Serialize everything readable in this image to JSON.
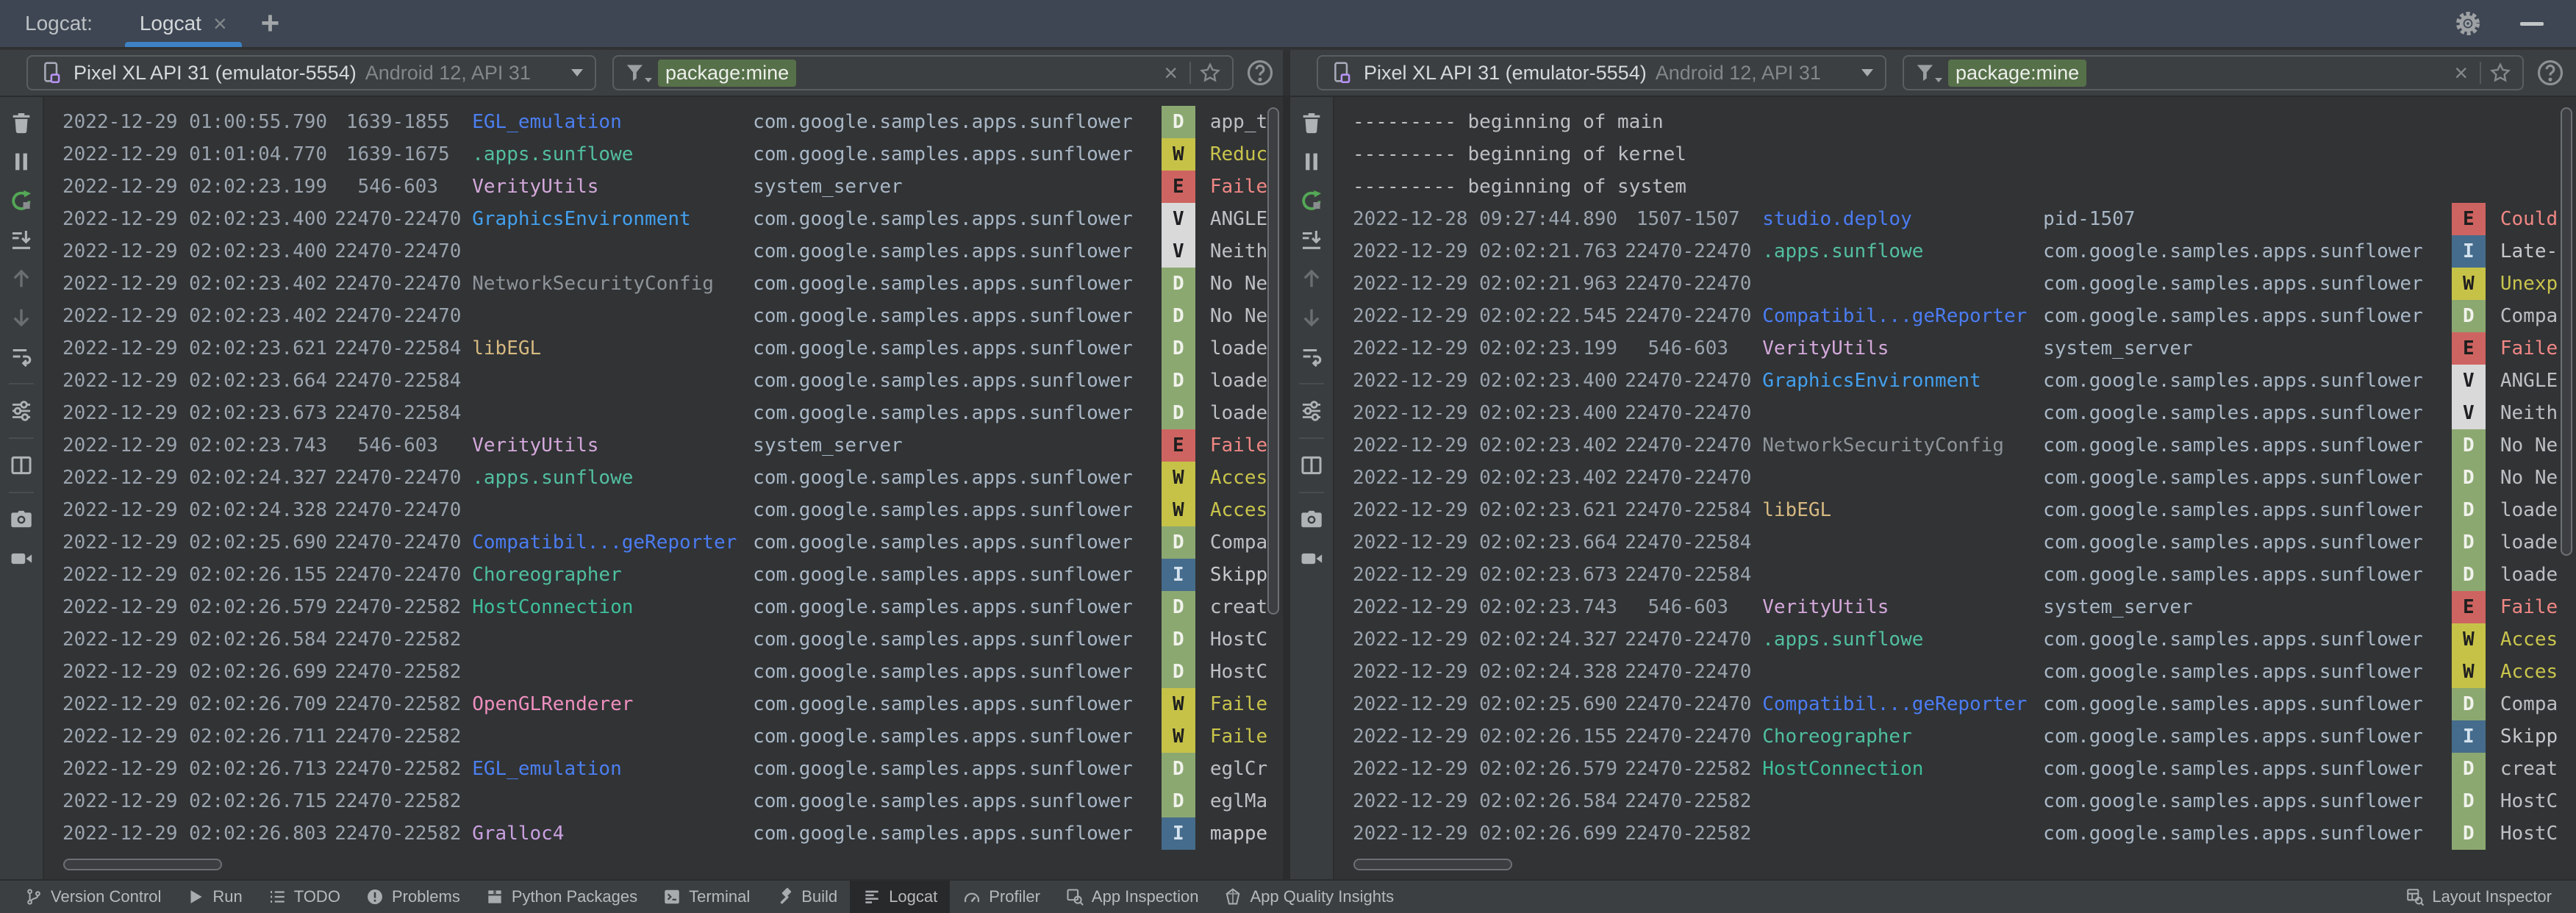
{
  "window": {
    "panel_label": "Logcat:",
    "tab_title": "Logcat",
    "close_glyph": "×",
    "add_glyph": "+"
  },
  "device_selector": {
    "device_name": "Pixel XL API 31 (emulator-5554)",
    "device_details": "Android 12, API 31"
  },
  "filter": {
    "token": "package:mine",
    "clear_glyph": "×",
    "help_glyph": "?"
  },
  "log_toolbar": [
    {
      "name": "clear-logcat",
      "icon": "trash"
    },
    {
      "name": "pause-logcat",
      "icon": "pause"
    },
    {
      "name": "restart-logcat",
      "icon": "restart"
    },
    {
      "name": "scroll-to-end",
      "icon": "scroll-end"
    },
    {
      "name": "previous-occurrence",
      "icon": "arrow-up",
      "dim": true
    },
    {
      "name": "next-occurrence",
      "icon": "arrow-down",
      "dim": true
    },
    {
      "name": "soft-wrap",
      "icon": "soft-wrap"
    },
    {
      "divider": true
    },
    {
      "name": "configure-logcat",
      "icon": "sliders"
    },
    {
      "divider": true
    },
    {
      "name": "split-panels",
      "icon": "split"
    },
    {
      "divider": true
    },
    {
      "name": "take-screenshot",
      "icon": "camera"
    },
    {
      "name": "record-screen",
      "icon": "video"
    }
  ],
  "panels": [
    {
      "rows": [
        [
          "2022-12-29 01:00:55.790",
          "1639-1855",
          "EGL_emulation",
          "com.google.samples.apps.sunflower",
          "D",
          "app_t"
        ],
        [
          "2022-12-29 01:01:04.770",
          "1639-1675",
          ".apps.sunflowe",
          "com.google.samples.apps.sunflower",
          "W",
          "Reduc"
        ],
        [
          "2022-12-29 02:02:23.199",
          "546-603",
          "VerityUtils",
          "system_server",
          "E",
          "Faile"
        ],
        [
          "2022-12-29 02:02:23.400",
          "22470-22470",
          "GraphicsEnvironment",
          "com.google.samples.apps.sunflower",
          "V",
          "ANGLE"
        ],
        [
          "2022-12-29 02:02:23.400",
          "22470-22470",
          "",
          "com.google.samples.apps.sunflower",
          "V",
          "Neith"
        ],
        [
          "2022-12-29 02:02:23.402",
          "22470-22470",
          "NetworkSecurityConfig",
          "com.google.samples.apps.sunflower",
          "D",
          "No Ne"
        ],
        [
          "2022-12-29 02:02:23.402",
          "22470-22470",
          "",
          "com.google.samples.apps.sunflower",
          "D",
          "No Ne"
        ],
        [
          "2022-12-29 02:02:23.621",
          "22470-22584",
          "libEGL",
          "com.google.samples.apps.sunflower",
          "D",
          "loade"
        ],
        [
          "2022-12-29 02:02:23.664",
          "22470-22584",
          "",
          "com.google.samples.apps.sunflower",
          "D",
          "loade"
        ],
        [
          "2022-12-29 02:02:23.673",
          "22470-22584",
          "",
          "com.google.samples.apps.sunflower",
          "D",
          "loade"
        ],
        [
          "2022-12-29 02:02:23.743",
          "546-603",
          "VerityUtils",
          "system_server",
          "E",
          "Faile"
        ],
        [
          "2022-12-29 02:02:24.327",
          "22470-22470",
          ".apps.sunflowe",
          "com.google.samples.apps.sunflower",
          "W",
          "Acces"
        ],
        [
          "2022-12-29 02:02:24.328",
          "22470-22470",
          "",
          "com.google.samples.apps.sunflower",
          "W",
          "Acces"
        ],
        [
          "2022-12-29 02:02:25.690",
          "22470-22470",
          "Compatibil...geReporter",
          "com.google.samples.apps.sunflower",
          "D",
          "Compa"
        ],
        [
          "2022-12-29 02:02:26.155",
          "22470-22470",
          "Choreographer",
          "com.google.samples.apps.sunflower",
          "I",
          "Skipp"
        ],
        [
          "2022-12-29 02:02:26.579",
          "22470-22582",
          "HostConnection",
          "com.google.samples.apps.sunflower",
          "D",
          "creat"
        ],
        [
          "2022-12-29 02:02:26.584",
          "22470-22582",
          "",
          "com.google.samples.apps.sunflower",
          "D",
          "HostC"
        ],
        [
          "2022-12-29 02:02:26.699",
          "22470-22582",
          "",
          "com.google.samples.apps.sunflower",
          "D",
          "HostC"
        ],
        [
          "2022-12-29 02:02:26.709",
          "22470-22582",
          "OpenGLRenderer",
          "com.google.samples.apps.sunflower",
          "W",
          "Faile"
        ],
        [
          "2022-12-29 02:02:26.711",
          "22470-22582",
          "",
          "com.google.samples.apps.sunflower",
          "W",
          "Faile"
        ],
        [
          "2022-12-29 02:02:26.713",
          "22470-22582",
          "EGL_emulation",
          "com.google.samples.apps.sunflower",
          "D",
          "eglCr"
        ],
        [
          "2022-12-29 02:02:26.715",
          "22470-22582",
          "",
          "com.google.samples.apps.sunflower",
          "D",
          "eglMa"
        ],
        [
          "2022-12-29 02:02:26.803",
          "22470-22582",
          "Gralloc4",
          "com.google.samples.apps.sunflower",
          "I",
          "mappe"
        ]
      ]
    },
    {
      "rows": [
        {
          "sep": "--------- beginning of main"
        },
        {
          "sep": "--------- beginning of kernel"
        },
        {
          "sep": "--------- beginning of system"
        },
        [
          "2022-12-28 09:27:44.890",
          "1507-1507",
          "studio.deploy",
          "pid-1507",
          "E",
          "Could"
        ],
        [
          "2022-12-29 02:02:21.763",
          "22470-22470",
          ".apps.sunflowe",
          "com.google.samples.apps.sunflower",
          "I",
          "Late-"
        ],
        [
          "2022-12-29 02:02:21.963",
          "22470-22470",
          "",
          "com.google.samples.apps.sunflower",
          "W",
          "Unexp"
        ],
        [
          "2022-12-29 02:02:22.545",
          "22470-22470",
          "Compatibil...geReporter",
          "com.google.samples.apps.sunflower",
          "D",
          "Compa"
        ],
        [
          "2022-12-29 02:02:23.199",
          "546-603",
          "VerityUtils",
          "system_server",
          "E",
          "Faile"
        ],
        [
          "2022-12-29 02:02:23.400",
          "22470-22470",
          "GraphicsEnvironment",
          "com.google.samples.apps.sunflower",
          "V",
          "ANGLE"
        ],
        [
          "2022-12-29 02:02:23.400",
          "22470-22470",
          "",
          "com.google.samples.apps.sunflower",
          "V",
          "Neith"
        ],
        [
          "2022-12-29 02:02:23.402",
          "22470-22470",
          "NetworkSecurityConfig",
          "com.google.samples.apps.sunflower",
          "D",
          "No Ne"
        ],
        [
          "2022-12-29 02:02:23.402",
          "22470-22470",
          "",
          "com.google.samples.apps.sunflower",
          "D",
          "No Ne"
        ],
        [
          "2022-12-29 02:02:23.621",
          "22470-22584",
          "libEGL",
          "com.google.samples.apps.sunflower",
          "D",
          "loade"
        ],
        [
          "2022-12-29 02:02:23.664",
          "22470-22584",
          "",
          "com.google.samples.apps.sunflower",
          "D",
          "loade"
        ],
        [
          "2022-12-29 02:02:23.673",
          "22470-22584",
          "",
          "com.google.samples.apps.sunflower",
          "D",
          "loade"
        ],
        [
          "2022-12-29 02:02:23.743",
          "546-603",
          "VerityUtils",
          "system_server",
          "E",
          "Faile"
        ],
        [
          "2022-12-29 02:02:24.327",
          "22470-22470",
          ".apps.sunflowe",
          "com.google.samples.apps.sunflower",
          "W",
          "Acces"
        ],
        [
          "2022-12-29 02:02:24.328",
          "22470-22470",
          "",
          "com.google.samples.apps.sunflower",
          "W",
          "Acces"
        ],
        [
          "2022-12-29 02:02:25.690",
          "22470-22470",
          "Compatibil...geReporter",
          "com.google.samples.apps.sunflower",
          "D",
          "Compa"
        ],
        [
          "2022-12-29 02:02:26.155",
          "22470-22470",
          "Choreographer",
          "com.google.samples.apps.sunflower",
          "I",
          "Skipp"
        ],
        [
          "2022-12-29 02:02:26.579",
          "22470-22582",
          "HostConnection",
          "com.google.samples.apps.sunflower",
          "D",
          "creat"
        ],
        [
          "2022-12-29 02:02:26.584",
          "22470-22582",
          "",
          "com.google.samples.apps.sunflower",
          "D",
          "HostC"
        ],
        [
          "2022-12-29 02:02:26.699",
          "22470-22582",
          "",
          "com.google.samples.apps.sunflower",
          "D",
          "HostC"
        ]
      ]
    }
  ],
  "status_bar": {
    "items": [
      {
        "label": "Version Control",
        "icon": "branch"
      },
      {
        "label": "Run",
        "icon": "play"
      },
      {
        "label": "TODO",
        "icon": "todo"
      },
      {
        "label": "Problems",
        "icon": "problems"
      },
      {
        "label": "Python Packages",
        "icon": "package"
      },
      {
        "label": "Terminal",
        "icon": "terminal"
      },
      {
        "label": "Build",
        "icon": "hammer"
      },
      {
        "label": "Logcat",
        "icon": "logcat",
        "active": true
      },
      {
        "label": "Profiler",
        "icon": "gauge"
      },
      {
        "label": "App Inspection",
        "icon": "inspect"
      },
      {
        "label": "App Quality Insights",
        "icon": "gem"
      }
    ],
    "right_items": [
      {
        "label": "Layout Inspector",
        "icon": "layout"
      }
    ]
  },
  "colors": {
    "tab_underline": "#3E82C4",
    "filter_token_bg": "#56704A",
    "meta_text": "#9AA3AD",
    "package_text": "#A9B7C6",
    "default_tag": "#BDC0C3",
    "levels": {
      "V": {
        "bg": "#D9D9D9",
        "fg": "#1E1F22",
        "msg": "#BDC0C3"
      },
      "D": {
        "bg": "#8CA871",
        "fg": "#F1F3EC",
        "msg": "#BDC0C3"
      },
      "I": {
        "bg": "#456C8C",
        "fg": "#D5E3EF",
        "msg": "#C6C9CB"
      },
      "W": {
        "bg": "#C6C248",
        "fg": "#1F1F1F",
        "msg": "#C9C44C"
      },
      "E": {
        "bg": "#CE6461",
        "fg": "#1E1E1E",
        "msg": "#F08784"
      }
    },
    "tags": {
      "EGL_emulation": "#4C7FF0",
      ".apps.sunflowe": "#53BFA0",
      "VerityUtils": "#D4A8DA",
      "GraphicsEnvironment": "#43A0EE",
      "NetworkSecurityConfig": "#8E9499",
      "libEGL": "#D6B980",
      "Compatibil...geReporter": "#4B7CF2",
      "Choreographer": "#4FBF9E",
      "HostConnection": "#3FBE9B",
      "OpenGLRenderer": "#EE8FBE",
      "Gralloc4": "#C9A0DF",
      "studio.deploy": "#4B7CF2"
    }
  }
}
